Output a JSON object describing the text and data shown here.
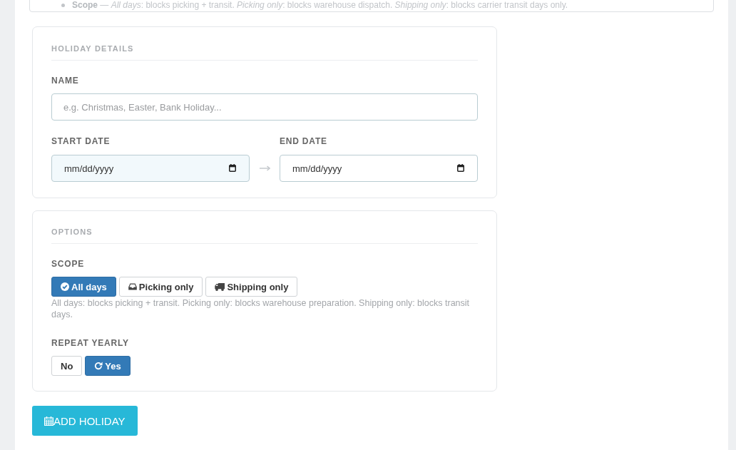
{
  "info_note": {
    "items": [
      {
        "text": "**Scope** — *All days*: blocks picking + transit. *Picking only*: blocks warehouse dispatch. *Shipping only*: blocks carrier transit days only."
      }
    ]
  },
  "holiday_details": {
    "title": "HOLIDAY DETAILS",
    "name": {
      "label": "NAME",
      "placeholder": "e.g. Christmas, Easter, Bank Holiday..."
    },
    "start_date": {
      "label": "START DATE",
      "placeholder": "mm/dd/yyyy",
      "focused": true
    },
    "end_date": {
      "label": "END DATE",
      "placeholder": "mm/dd/yyyy",
      "focused": false
    }
  },
  "options": {
    "title": "OPTIONS",
    "scope": {
      "label": "SCOPE",
      "choices": [
        {
          "label": "All days",
          "selected": true
        },
        {
          "label": "Picking only",
          "selected": false
        },
        {
          "label": "Shipping only",
          "selected": false
        }
      ],
      "help": "All days: blocks picking + transit. Picking only: blocks warehouse preparation. Shipping only: blocks transit days."
    },
    "repeat_yearly": {
      "label": "REPEAT YEARLY",
      "choices": [
        {
          "label": "No",
          "selected": false
        },
        {
          "label": "Yes",
          "selected": true
        }
      ]
    }
  },
  "add_button": {
    "label": "ADD HOLIDAY"
  }
}
